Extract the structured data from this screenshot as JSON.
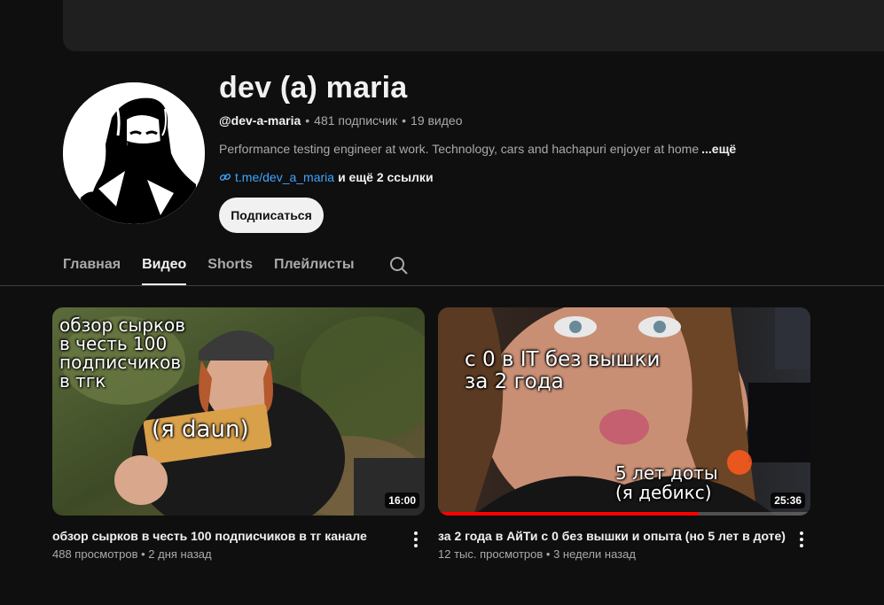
{
  "channel": {
    "title": "dev (a) maria",
    "handle": "@dev-a-maria",
    "subscribers": "481 подписчик",
    "videos_count": "19 видео",
    "description": "Performance testing engineer at work. Technology, cars and hachapuri enjoyer at home",
    "description_more": "...ещё",
    "link_text": "t.me/dev_a_maria",
    "more_links": "и ещё 2 ссылки",
    "subscribe_label": "Подписаться"
  },
  "tabs": [
    {
      "label": "Главная",
      "active": false
    },
    {
      "label": "Видео",
      "active": true
    },
    {
      "label": "Shorts",
      "active": false
    },
    {
      "label": "Плейлисты",
      "active": false
    }
  ],
  "videos": [
    {
      "title": "обзор сырков в честь 100 подписчиков в тг канале",
      "views": "488 просмотров",
      "age": "2 дня назад",
      "duration": "16:00",
      "overlay_lines": [
        "обзор сырков",
        "в честь 100",
        "подписчиков",
        "в тгк"
      ],
      "overlay_caption": "(я daun)",
      "watch_progress": 0
    },
    {
      "title": "за 2 года в АйТи с 0 без вышки и опыта (но 5 лет в доте)",
      "views": "12 тыс. просмотров",
      "age": "3 недели назад",
      "duration": "25:36",
      "overlay_lines": [
        "с 0 в IT без вышки",
        "за 2 года"
      ],
      "overlay_caption_lines": [
        "5 лет доты",
        "(я дебикс)"
      ],
      "watch_progress": 0.7
    }
  ],
  "icons": {
    "search": "search-icon",
    "link": "link-icon",
    "menu": "more-vert-icon"
  },
  "colors": {
    "background": "#0f0f0f",
    "link": "#3ea6ff",
    "progress": "#ff0000"
  }
}
